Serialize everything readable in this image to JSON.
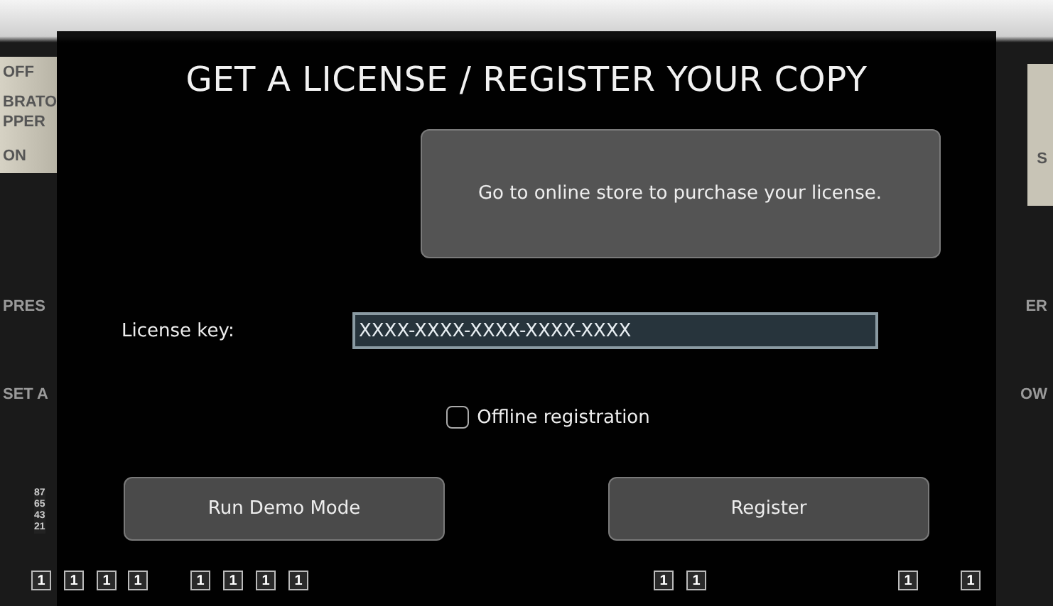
{
  "background_panel": {
    "left_labels": [
      "OFF",
      "BRATO",
      "PPER",
      "ON",
      "PRES",
      "SET A"
    ],
    "right_labels": [
      "S",
      "ER",
      "OW"
    ],
    "scale": "87654321",
    "drawbar_keys": [
      {
        "label": "1"
      },
      {
        "label": "1"
      },
      {
        "label": "1"
      },
      {
        "label": "1"
      },
      {
        "label": "1"
      },
      {
        "label": "1"
      },
      {
        "label": "1"
      },
      {
        "label": "1"
      },
      {
        "label": "1"
      },
      {
        "label": "1"
      },
      {
        "label": "1"
      },
      {
        "label": "1"
      }
    ]
  },
  "dialog": {
    "title": "GET A LICENSE / REGISTER YOUR COPY",
    "store_button": "Go to online store to purchase your license.",
    "license_key": {
      "label": "License key:",
      "value": "XXXX-XXXX-XXXX-XXXX-XXXX"
    },
    "offline_registration": {
      "label": "Offline registration",
      "checked": false
    },
    "buttons": [
      {
        "label": "Run Demo Mode"
      },
      {
        "label": "Register"
      }
    ]
  }
}
